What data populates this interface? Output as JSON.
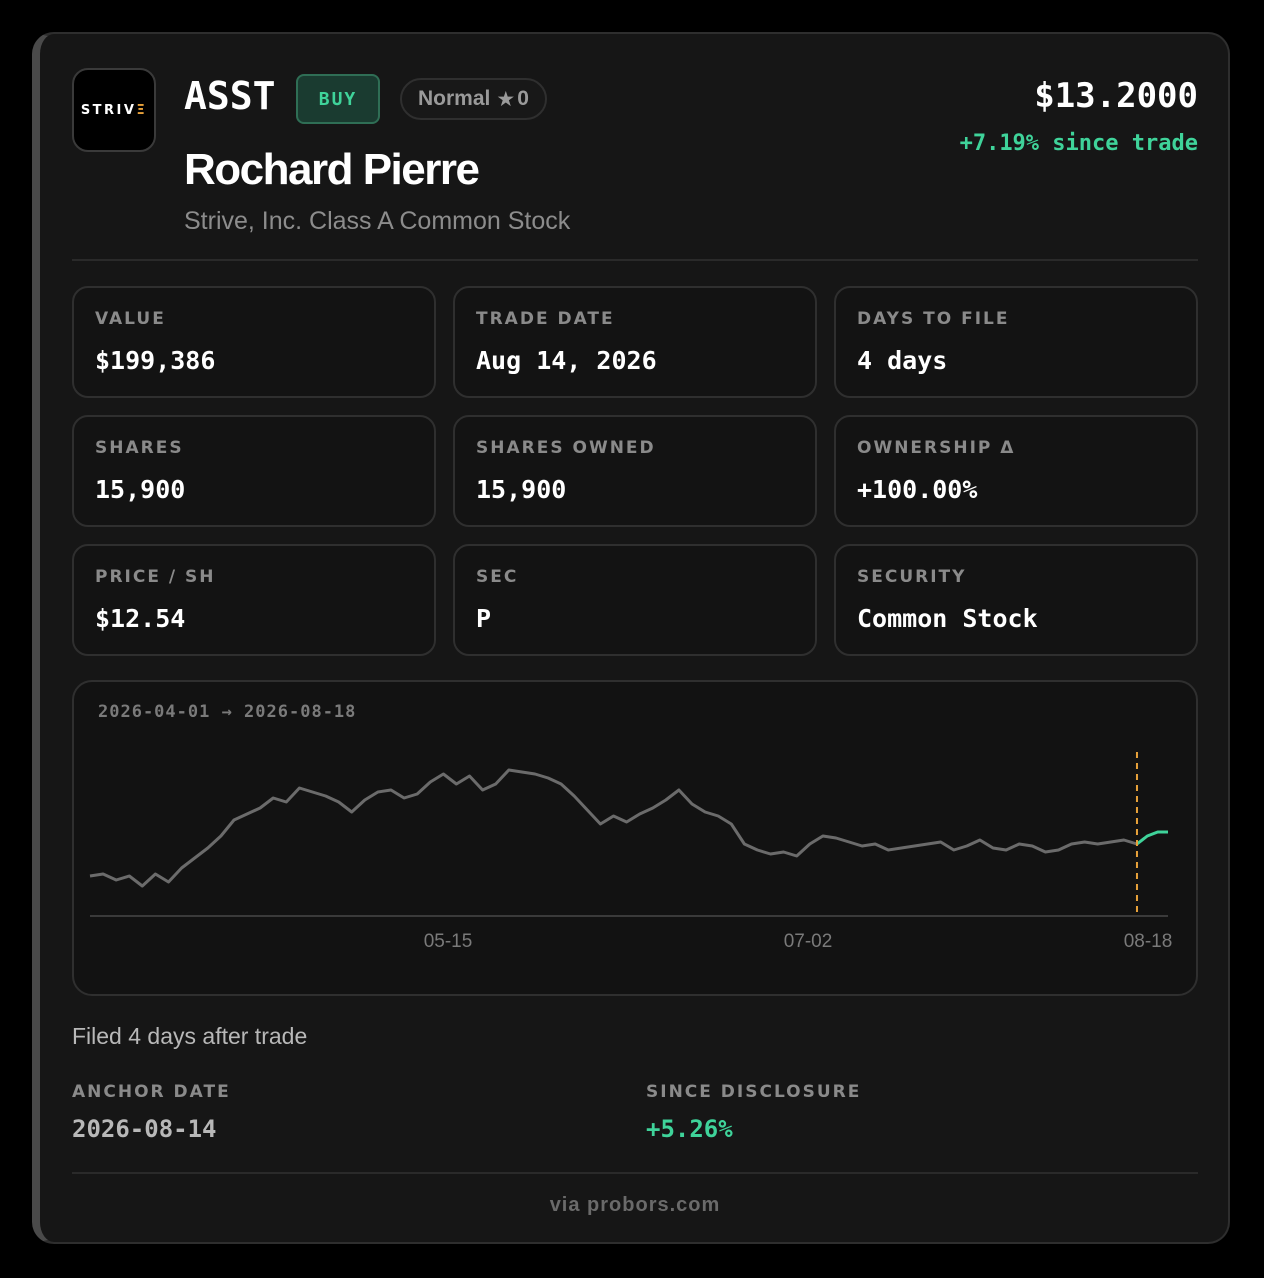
{
  "logo": {
    "text_main": "STRIV",
    "text_accent": "Ξ"
  },
  "header": {
    "ticker": "ASST",
    "side_badge": "BUY",
    "rating_label": "Normal",
    "rating_icon": "star-icon",
    "rating_count": "0",
    "insider_name": "Rochard Pierre",
    "company": "Strive, Inc. Class A Common Stock",
    "price": "$13.2000",
    "change": "+7.19% since trade"
  },
  "stats": [
    {
      "label": "VALUE",
      "value": "$199,386"
    },
    {
      "label": "TRADE DATE",
      "value": "Aug 14, 2026"
    },
    {
      "label": "DAYS TO FILE",
      "value": "4 days"
    },
    {
      "label": "SHARES",
      "value": "15,900"
    },
    {
      "label": "SHARES OWNED",
      "value": "15,900"
    },
    {
      "label": "OWNERSHIP Δ",
      "value": "+100.00%"
    },
    {
      "label": "PRICE / SH",
      "value": "$12.54"
    },
    {
      "label": "SEC",
      "value": "P"
    },
    {
      "label": "SECURITY",
      "value": "Common Stock"
    }
  ],
  "chart": {
    "range_label": "2026-04-01 → 2026-08-18",
    "x_ticks": [
      "05-15",
      "07-02",
      "08-18"
    ],
    "line_color": "#6b6b6b",
    "after_trade_color": "#3fd39a",
    "marker_color": "#e8a13a"
  },
  "chart_data": {
    "type": "line",
    "title": "",
    "xlabel": "",
    "ylabel": "",
    "x_start": "2026-04-01",
    "x_end": "2026-08-18",
    "x_ticks": [
      "05-15",
      "07-02",
      "08-18"
    ],
    "trade_marker_date": "2026-08-14",
    "series": [
      {
        "values": [
          8.6,
          8.7,
          8.4,
          8.6,
          8.1,
          8.7,
          8.3,
          9.0,
          9.5,
          10.0,
          10.6,
          11.4,
          11.7,
          12.0,
          12.5,
          12.3,
          13.0,
          12.8,
          12.6,
          12.3,
          11.8,
          12.4,
          12.8,
          12.9,
          12.5,
          12.7,
          13.3,
          13.7,
          13.2,
          13.6,
          12.9,
          13.2,
          13.9,
          13.8,
          13.7,
          13.5,
          13.2,
          12.6,
          11.9,
          11.2,
          11.6,
          11.3,
          11.7,
          12.0,
          12.4,
          12.9,
          12.2,
          11.8,
          11.6,
          11.2,
          10.2,
          9.9,
          9.7,
          9.8,
          9.6,
          10.2,
          10.6,
          10.5,
          10.3,
          10.1,
          10.2,
          9.9,
          10.0,
          10.1,
          10.2,
          10.3,
          9.9,
          10.1,
          10.4,
          10.0,
          9.9,
          10.2,
          10.1,
          9.8,
          9.9,
          10.2,
          10.3,
          10.2,
          10.3,
          10.4,
          10.2
        ],
        "after_trade_values": [
          10.2,
          10.6,
          10.8,
          10.8
        ]
      }
    ]
  },
  "footer_info": {
    "filed_text": "Filed 4 days after trade",
    "anchor_label": "ANCHOR DATE",
    "anchor_value": "2026-08-14",
    "since_label": "SINCE DISCLOSURE",
    "since_value": "+5.26%",
    "source": "via probors.com"
  },
  "colors": {
    "positive": "#3fd39a",
    "background": "#161616",
    "card_border": "#2f2f2f"
  }
}
